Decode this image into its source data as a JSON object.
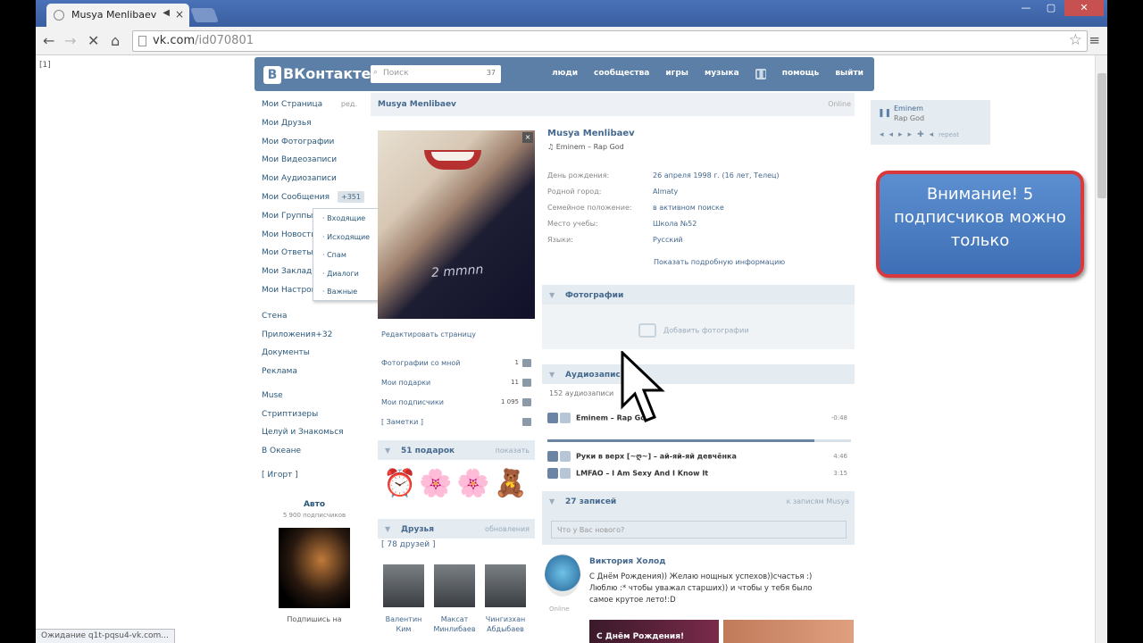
{
  "browser": {
    "tab_title": "Musya Menlibaev",
    "url_host": "vk.com",
    "url_path": "/id070801",
    "status_text": "Ожидание q1t-pqsu4-vk.com..."
  },
  "frame_counter": "[1]",
  "vk": {
    "logo": "ВКонтакте",
    "search_placeholder": "Поиск",
    "search_count": "37",
    "nav": [
      "люди",
      "сообщества",
      "игры",
      "музыка",
      "помощь",
      "выйти"
    ],
    "left_menu": [
      {
        "label": "Мои Страница",
        "extra": "ред."
      },
      {
        "label": "Мои Друзья"
      },
      {
        "label": "Мои Фотографии"
      },
      {
        "label": "Мои Видеозаписи"
      },
      {
        "label": "Мои Аудиозаписи"
      },
      {
        "label": "Мои Сообщения",
        "badge": "+351"
      },
      {
        "label": "Мои Группы"
      },
      {
        "label": "Мои Новости"
      },
      {
        "label": "Мои Ответы"
      },
      {
        "label": "Мои Закладки"
      },
      {
        "label": "Мои Настройки"
      }
    ],
    "left_menu2": [
      {
        "label": "Стена"
      },
      {
        "label": "Приложения",
        "badge": "+32"
      },
      {
        "label": "Документы"
      },
      {
        "label": "Реклама"
      }
    ],
    "left_menu3": [
      "Muse",
      "Стриптизеры",
      "Целуй и Знакомься",
      "В Океане"
    ],
    "ad_tag": "[ Игорт ]",
    "ad": {
      "title": "Авто",
      "subscribers": "5 900 подписчиков",
      "caption": "Подпишись на"
    },
    "dropdown": [
      "Входящие",
      "Исходящие",
      "Спам",
      "Диалоги",
      "Важные"
    ],
    "profile": {
      "name": "Musya Menlibaev",
      "online": "Online",
      "status": "Eminem – Rap God",
      "photo_text": "2 mmnn",
      "edit_link": "Редактировать страницу",
      "links": [
        {
          "label": "Фотографии со мной",
          "count": "1"
        },
        {
          "label": "Мои подарки",
          "count": "11"
        },
        {
          "label": "Мои подписчики",
          "count": "1 095"
        },
        {
          "label": "[ Заметки ]",
          "count": ""
        }
      ],
      "gifts_title": "51 подарок",
      "gifts_more": "показать",
      "gifts": [
        "⏰",
        "🌸",
        "🌸",
        "🧸"
      ],
      "friends_title": "Друзья",
      "friends_more": "обновления",
      "friends_count": "[ 78 друзей ]",
      "friends": [
        {
          "name": "Валентин Ким"
        },
        {
          "name": "Максат Минлибаев"
        },
        {
          "name": "Чингизхан Абдыбаев"
        }
      ]
    },
    "info": {
      "rows": [
        {
          "k": "День рождения:",
          "v": "26 апреля 1998 г. (16 лет, Телец)"
        },
        {
          "k": "Родной город:",
          "v": "Almaty"
        },
        {
          "k": "Семейное положение:",
          "v": "в активном поиске"
        },
        {
          "k": "Место учебы:",
          "v": "Школа №52"
        },
        {
          "k": "Языки:",
          "v": "Русский"
        }
      ],
      "more": "Показать подробную информацию"
    },
    "photos_title": "Фотографии",
    "photos_add": "Добавить фотографии",
    "audio_title": "Аудиозаписи",
    "audio_count": "152 аудиозаписи",
    "tracks": [
      {
        "name": "Eminem – Rap God",
        "duration": "-0:48"
      },
      {
        "name": "Руки в верх [~ღ~] – ай-яй-яй девчёнка",
        "duration": "4:46"
      },
      {
        "name": "LMFAO – I Am Sexy And I Know It",
        "duration": "3:15"
      }
    ],
    "progress": 0.88,
    "wall_title": "27 записей",
    "wall_filter": "к записям Мusya",
    "wall_placeholder": "Что у Вас нового?",
    "post": {
      "author": "Виктория Холод",
      "online": "Online",
      "text": "С Днём Рождения)) Желаю нощных успехов))счастья :) Люблю :* чтобы уважал старших)) и чтобы у тебя было самое крутое лето!:D",
      "image_text": "С Днём Рождения!"
    },
    "miniplayer": {
      "artist": "Eminem",
      "title": "Rap God",
      "mode": "repeat"
    }
  },
  "callout": "Внимание! 5 подписчиков можно только"
}
